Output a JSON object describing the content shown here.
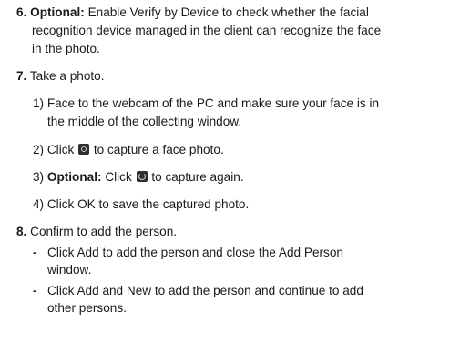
{
  "step6": {
    "number": "6.",
    "optional_label": "Optional:",
    "text_line1": "Enable Verify by Device to check whether the facial",
    "text_line2": "recognition device managed in the client can recognize the face",
    "text_line3": "in the photo."
  },
  "step7": {
    "number": "7.",
    "text": "Take a photo.",
    "sub1": {
      "line1": "1) Face to the webcam of the PC and make sure your face is in",
      "line2": "the middle of the collecting window."
    },
    "sub2": {
      "prefix": "2) Click",
      "icon": "camera-capture-icon",
      "suffix": "to capture a face photo."
    },
    "sub3": {
      "prefix": "3)",
      "optional_label": "Optional:",
      "click": "Click",
      "icon": "retake-icon",
      "suffix": "to capture again."
    },
    "sub4": {
      "text": "4) Click OK to save the captured photo."
    }
  },
  "step8": {
    "number": "8.",
    "text": "Confirm to add the person.",
    "bullets": [
      {
        "dash": "-",
        "line1": "Click Add to add the person and close the Add Person",
        "line2": "window."
      },
      {
        "dash": "-",
        "line1": "Click Add and New to add the person and continue to add",
        "line2": "other persons."
      }
    ]
  }
}
